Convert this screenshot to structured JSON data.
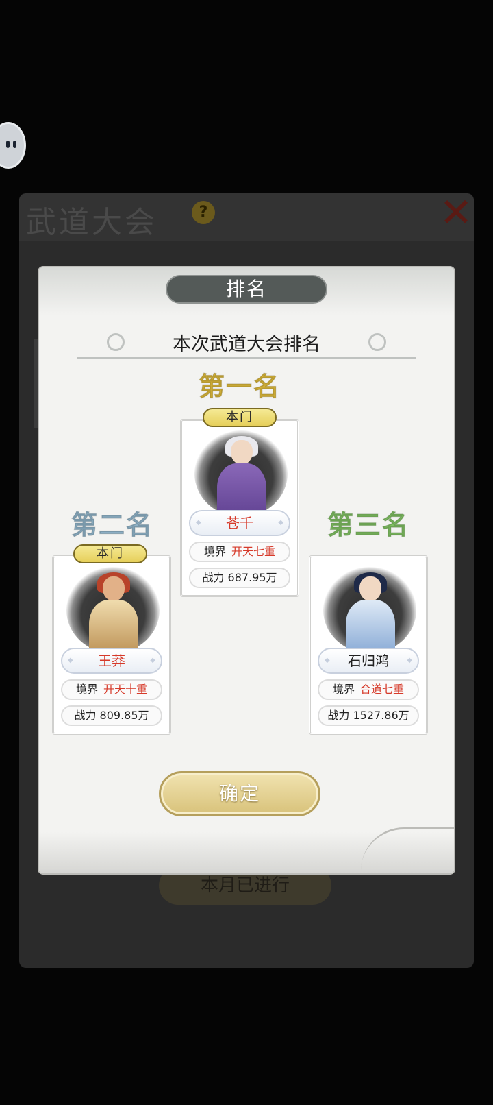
{
  "background": {
    "title": "武道大会",
    "help_symbol": "?",
    "close_symbol": "✕",
    "month_status": "本月已进行"
  },
  "modal": {
    "title": "排名",
    "subtitle": "本次武道大会排名",
    "confirm_label": "确定",
    "realm_label": "境界",
    "power_label": "战力"
  },
  "rankings": [
    {
      "rank_label": "第一名",
      "sect_badge": "本门",
      "name": "苍千",
      "realm": "开天七重",
      "power": "687.95万",
      "rank_color": "#d8b53a",
      "name_color": "#d63a2a"
    },
    {
      "rank_label": "第二名",
      "sect_badge": "本门",
      "name": "王莽",
      "realm": "开天十重",
      "power": "809.85万",
      "rank_color": "#8fb2c7",
      "name_color": "#d63a2a"
    },
    {
      "rank_label": "第三名",
      "sect_badge": "",
      "name": "石归鸿",
      "realm": "合道七重",
      "power": "1527.86万",
      "rank_color": "#7fbf62",
      "name_color": "#222222"
    }
  ],
  "icons": {
    "floating_button": "chat-bubble-icon",
    "help": "question-icon",
    "close": "close-icon"
  }
}
